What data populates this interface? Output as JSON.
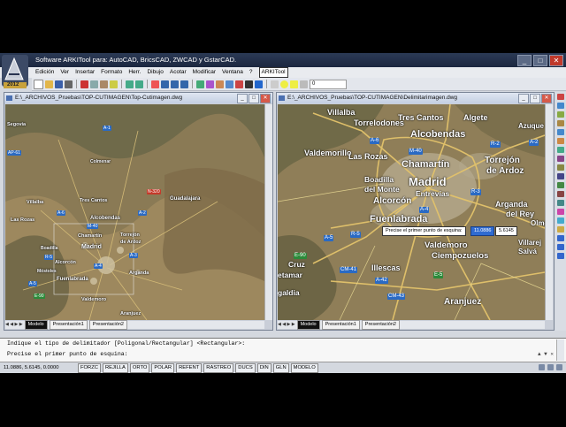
{
  "window": {
    "title": "Software ARKITool para: AutoCAD, BricsCAD, ZWCAD y GstarCAD.",
    "logo_year": "2012",
    "buttons": {
      "minimize": "_",
      "maximize": "□",
      "close": "✕"
    }
  },
  "menu": [
    {
      "label": "Edición"
    },
    {
      "label": "Ver"
    },
    {
      "label": "Insertar"
    },
    {
      "label": "Formato"
    },
    {
      "label": "Herr."
    },
    {
      "label": "Dibujo"
    },
    {
      "label": "Acotar"
    },
    {
      "label": "Modificar"
    },
    {
      "label": "Ventana"
    },
    {
      "label": "?"
    },
    {
      "label": "ARKITool",
      "selected": true
    }
  ],
  "toolbar": {
    "layer_value": "0"
  },
  "doc_left": {
    "title": "E:\\_ARCHIVOS_Pruebas\\TOP-CUTIMAGEN\\Top-Cutimagen.dwg",
    "tabs": [
      "Modelo",
      "Presentación1",
      "Presentación2"
    ],
    "labels": [
      "Segovia",
      "Villalba",
      "Las Rozas",
      "Alcobendas",
      "Torrejón",
      "de Ardoz",
      "Madrid",
      "Chamartín",
      "Alcorcón",
      "Fuenlabrada",
      "Arganda",
      "Valdemoro",
      "Aranjuez",
      "Guadalajara",
      "Tres Cantos",
      "Colmenar",
      "Boadilla",
      "Móstoles"
    ],
    "roads": [
      "A-6",
      "A-1",
      "M-40",
      "A-2",
      "A-3",
      "A-4",
      "A-5",
      "R-5",
      "N-320",
      "E-90",
      "AP-61"
    ]
  },
  "doc_right": {
    "title": "E:\\_ARCHIVOS_Pruebas\\TOP-CUTIMAGEN\\Delimitarimagen.dwg",
    "tabs": [
      "Modelo",
      "Presentación1",
      "Presentación2"
    ],
    "labels": {
      "villalba": "Villalba",
      "torrelodones": "Torrelodones",
      "tres_cantos": "Tres Cantos",
      "algete": "Algete",
      "azuqueca": "Azuque",
      "alcobendas": "Alcobendas",
      "valdemorillo": "Valdemorillo",
      "las_rozas": "Las Rozas",
      "chamartin": "Chamartín",
      "torrejon": "Torrejón",
      "de_ardoz": "de Ardoz",
      "boadilla": "Boadilla",
      "del_monte": "del Monte",
      "madrid": "Madrid",
      "entrevias": "Entrevías",
      "alcorcon": "Alcorcón",
      "fuenlabrada": "Fuenlabrada",
      "arganda": "Arganda",
      "del_rey": "del Rey",
      "valdemoro": "Valdemoro",
      "ciempozuelos": "Ciempozuelos",
      "villarejo": "Villarej",
      "salva": "Salvá",
      "cruz": "Cruz",
      "retamar": "etamar",
      "illescas": "Illescas",
      "aranjuez": "Aranjuez",
      "olmedo": "Olme",
      "ganaldia": "galdia"
    },
    "roads": {
      "a6": "A-6",
      "m40": "M-40",
      "r2": "R-2",
      "a4": "A-4",
      "r3": "R-3",
      "a5": "A-5",
      "r5": "R-5",
      "e90": "E-90",
      "cm41": "CM-41",
      "a42": "A-42",
      "e5": "E-5",
      "cm43": "CM-43",
      "a2": "A-2"
    },
    "tooltip": {
      "prompt": "Precise el primer punto de esquina:",
      "x": "11.0886",
      "y": "5.6145"
    }
  },
  "command": {
    "line1": "Indique el tipo de delimitador [Poligonal/Rectangular] <Rectangular>:",
    "line2": "Precise el primer punto de esquina:",
    "controls": "▲ ▼ ✕"
  },
  "status": {
    "coords": "11.0886, 5.6145, 0.0000",
    "modes": [
      "FORZC",
      "REJILLA",
      "ORTO",
      "POLAR",
      "REFENT",
      "RASTREO",
      "DUCS",
      "DIN",
      "GLN",
      "MODELO"
    ]
  },
  "colors": {
    "title_bar": "#1c2740",
    "accent": "#2f6bd1",
    "map_base": "#8f7e58"
  }
}
